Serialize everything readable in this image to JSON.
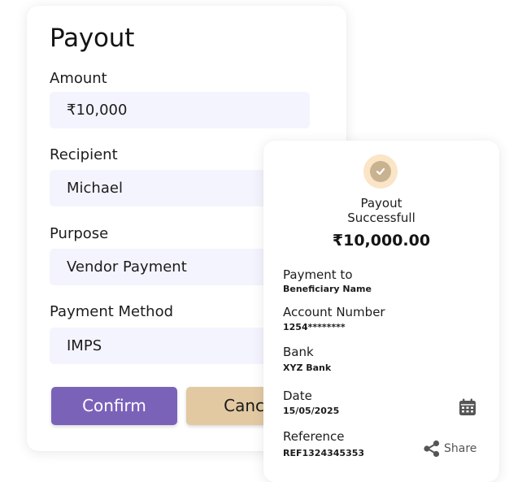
{
  "payout_form": {
    "title": "Payout",
    "amount_label": "Amount",
    "amount_value": "₹10,000",
    "recipient_label": "Recipient",
    "recipient_value": "Michael",
    "purpose_label": "Purpose",
    "purpose_value": "Vendor Payment",
    "method_label": "Payment Method",
    "method_value": "IMPS",
    "confirm_label": "Confirm",
    "cancel_label": "Cancel"
  },
  "receipt": {
    "status_line1": "Payout",
    "status_line2": "Successfull",
    "amount": "₹10,000.00",
    "payment_to_label": "Payment to",
    "payment_to_value": "Beneficiary Name",
    "account_label": "Account Number",
    "account_value": "1254********",
    "bank_label": "Bank",
    "bank_value": "XYZ Bank",
    "date_label": "Date",
    "date_value": "15/05/2025",
    "reference_label": "Reference",
    "reference_value": "REF1324345353",
    "share_label": "Share"
  },
  "icons": {
    "success": "check-circle-icon",
    "date": "calendar-icon",
    "share": "share-icon"
  },
  "colors": {
    "primary": "#7b62b9",
    "secondary": "#e2c9a2",
    "input_bg": "#f4f4ff",
    "badge_outer": "#fae5c7",
    "badge_inner": "#c9b28f"
  }
}
